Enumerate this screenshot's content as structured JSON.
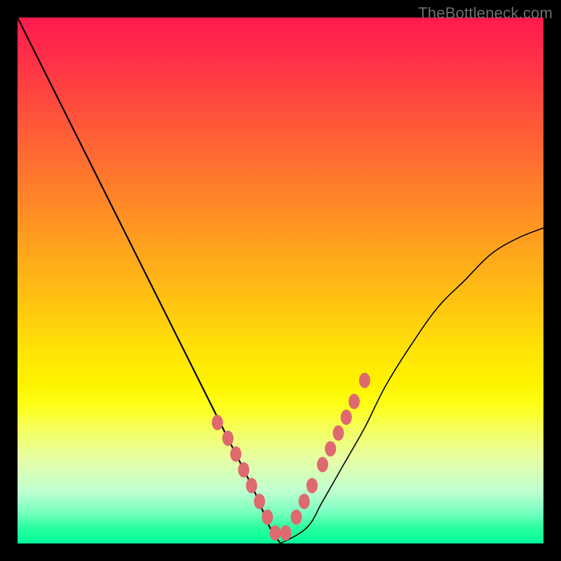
{
  "watermark": "TheBottleneck.com",
  "chart_data": {
    "type": "line",
    "title": "",
    "xlabel": "",
    "ylabel": "",
    "xlim": [
      0,
      100
    ],
    "ylim": [
      0,
      100
    ],
    "curve_left": {
      "x": [
        0,
        5,
        10,
        15,
        20,
        25,
        30,
        35,
        40,
        45,
        48,
        50
      ],
      "y": [
        100,
        90,
        80,
        70,
        60,
        50,
        40,
        30,
        20,
        10,
        3,
        0
      ]
    },
    "curve_right": {
      "x": [
        50,
        55,
        58,
        62,
        66,
        70,
        75,
        80,
        85,
        90,
        95,
        100
      ],
      "y": [
        0,
        3,
        8,
        15,
        22,
        30,
        38,
        45,
        50,
        55,
        58,
        60
      ]
    },
    "markers_left": {
      "x": [
        38,
        40,
        41.5,
        43,
        44.5,
        46,
        47.5,
        49
      ],
      "y": [
        23,
        20,
        17,
        14,
        11,
        8,
        5,
        2
      ]
    },
    "markers_right": {
      "x": [
        51,
        53,
        54.5,
        56,
        58,
        59.5,
        61,
        62.5,
        64,
        66
      ],
      "y": [
        2,
        5,
        8,
        11,
        15,
        18,
        21,
        24,
        27,
        31
      ]
    }
  }
}
